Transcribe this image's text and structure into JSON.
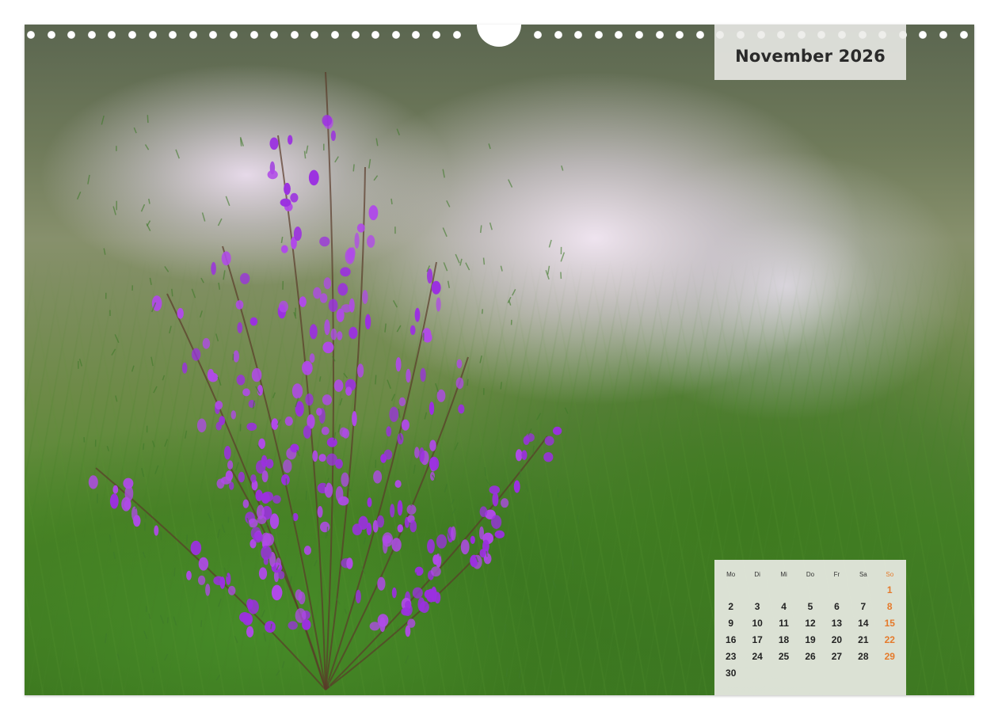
{
  "calendar": {
    "title": "November 2026",
    "weekdays": [
      "Mo",
      "Di",
      "Mi",
      "Do",
      "Fr",
      "Sa",
      "So"
    ],
    "weeks": [
      [
        "",
        "",
        "",
        "",
        "",
        "",
        "1"
      ],
      [
        "2",
        "3",
        "4",
        "5",
        "6",
        "7",
        "8"
      ],
      [
        "9",
        "10",
        "11",
        "12",
        "13",
        "14",
        "15"
      ],
      [
        "16",
        "17",
        "18",
        "19",
        "20",
        "21",
        "22"
      ],
      [
        "23",
        "24",
        "25",
        "26",
        "27",
        "28",
        "29"
      ],
      [
        "30",
        "",
        "",
        "",
        "",
        "",
        ""
      ]
    ],
    "sunday_color": "#e57a2b"
  },
  "photo": {
    "subject-icon": "heather-flower-icon"
  }
}
